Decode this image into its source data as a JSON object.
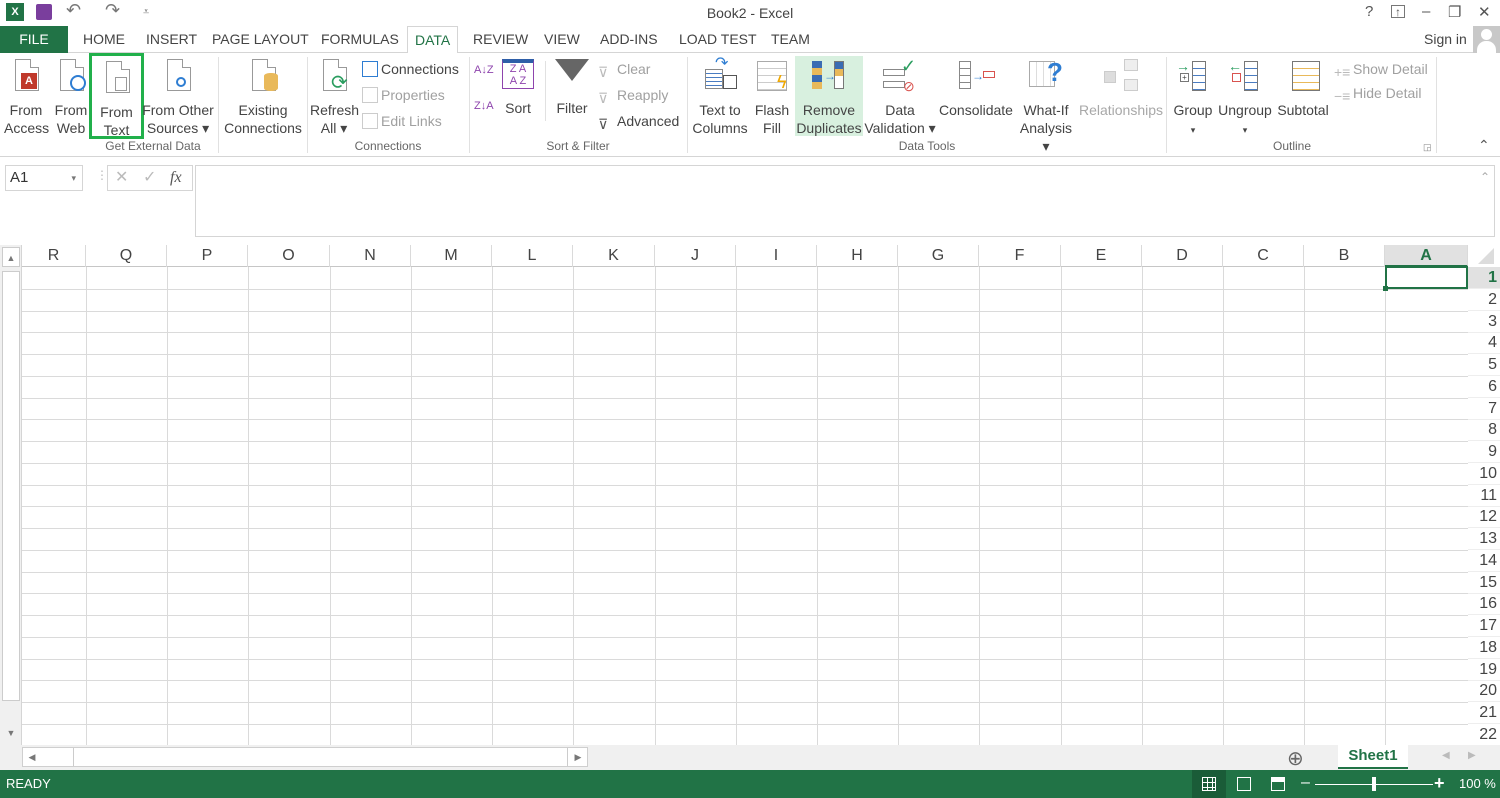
{
  "window": {
    "title": "Book2 - Excel",
    "help": "?",
    "ribbon_display": "⊼",
    "minimize": "–",
    "restore": "❐",
    "close": "✕"
  },
  "qat": {
    "app_icon": "X",
    "save": "save-icon",
    "undo": "↶",
    "redo": "↷",
    "customize": "⩡"
  },
  "tabs": [
    {
      "label": "FILE"
    },
    {
      "label": "HOME"
    },
    {
      "label": "INSERT"
    },
    {
      "label": "PAGE LAYOUT"
    },
    {
      "label": "FORMULAS"
    },
    {
      "label": "DATA",
      "active": true
    },
    {
      "label": "REVIEW"
    },
    {
      "label": "VIEW"
    },
    {
      "label": "ADD-INS"
    },
    {
      "label": "LOAD TEST"
    },
    {
      "label": "TEAM"
    }
  ],
  "account": {
    "sign_in": "Sign in"
  },
  "ribbon": {
    "get_external": {
      "label": "Get External Data",
      "from_access": [
        "From",
        "Access"
      ],
      "from_web": [
        "From",
        "Web"
      ],
      "from_text": [
        "From",
        "Text"
      ],
      "from_other": [
        "From Other",
        "Sources ▾"
      ],
      "existing": [
        "Existing",
        "Connections"
      ]
    },
    "connections": {
      "label": "Connections",
      "refresh": [
        "Refresh",
        "All ▾"
      ],
      "connections": "Connections",
      "properties": "Properties",
      "edit_links": "Edit Links"
    },
    "sort_filter": {
      "label": "Sort & Filter",
      "sort_az": "A↓Z",
      "sort_za": "Z↓A",
      "sort": "Sort",
      "filter": "Filter",
      "clear": "Clear",
      "reapply": "Reapply",
      "advanced": "Advanced"
    },
    "data_tools": {
      "label": "Data Tools",
      "text_to_columns": [
        "Text to",
        "Columns"
      ],
      "flash_fill": [
        "Flash",
        "Fill"
      ],
      "remove_duplicates": [
        "Remove",
        "Duplicates"
      ],
      "data_validation": [
        "Data",
        "Validation ▾"
      ],
      "consolidate": "Consolidate",
      "what_if": [
        "What-If",
        "Analysis ▾"
      ],
      "relationships": "Relationships"
    },
    "outline": {
      "label": "Outline",
      "group": [
        "Group",
        "▾"
      ],
      "ungroup": [
        "Ungroup",
        "▾"
      ],
      "subtotal": "Subtotal",
      "show_detail": "Show Detail",
      "hide_detail": "Hide Detail"
    }
  },
  "formula_bar": {
    "name_box": "A1",
    "cancel": "✕",
    "enter": "✓",
    "fx": "fx",
    "value": ""
  },
  "sheet": {
    "columns": [
      "R",
      "Q",
      "P",
      "O",
      "N",
      "M",
      "L",
      "K",
      "J",
      "I",
      "H",
      "G",
      "F",
      "E",
      "D",
      "C",
      "B",
      "A"
    ],
    "rows": [
      "1",
      "2",
      "3",
      "4",
      "5",
      "6",
      "7",
      "8",
      "9",
      "10",
      "11",
      "12",
      "13",
      "14",
      "15",
      "16",
      "17",
      "18",
      "19",
      "20",
      "21",
      "22"
    ],
    "selected_cell": "A1"
  },
  "sheet_tabs": {
    "add": "⊕",
    "tabs": [
      "Sheet1"
    ],
    "active": "Sheet1"
  },
  "status_bar": {
    "mode": "READY",
    "zoom_label": "100 %",
    "zoom_percent": 100,
    "zoom_minus": "–",
    "zoom_plus": "+"
  }
}
